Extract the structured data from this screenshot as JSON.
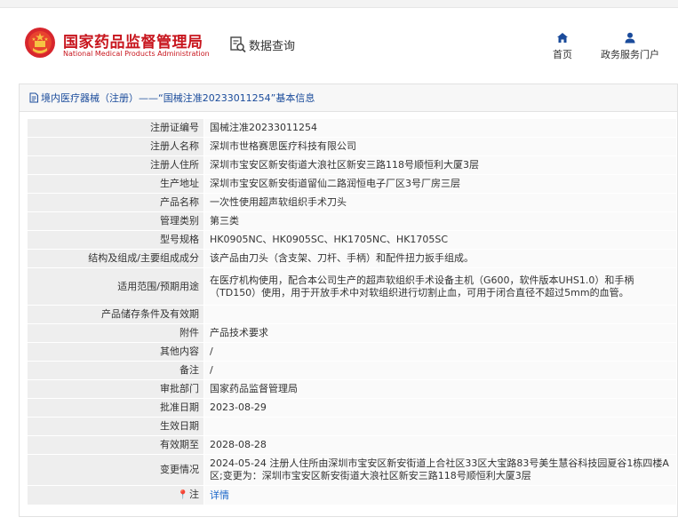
{
  "header": {
    "brand_cn": "国家药品监督管理局",
    "brand_en": "National Medical Products Administration",
    "query_label": "数据查询",
    "nav": [
      {
        "label": "首页",
        "icon": "home-icon"
      },
      {
        "label": "政务服务门户",
        "icon": "user-icon"
      }
    ]
  },
  "breadcrumb": "境内医疗器械（注册）——“国械注准20233011254”基本信息",
  "colors": {
    "brand_red": "#c8161e",
    "link_blue": "#1a66c9",
    "crumb_blue": "#1a4b9b"
  },
  "fields": [
    {
      "label": "注册证编号",
      "value": "国械注准20233011254"
    },
    {
      "label": "注册人名称",
      "value": "深圳市世格赛思医疗科技有限公司"
    },
    {
      "label": "注册人住所",
      "value": "深圳市宝安区新安街道大浪社区新安三路118号顺恒利大厦3层"
    },
    {
      "label": "生产地址",
      "value": "深圳市宝安区新安街道留仙二路润恒电子厂区3号厂房三层"
    },
    {
      "label": "产品名称",
      "value": "一次性使用超声软组织手术刀头"
    },
    {
      "label": "管理类别",
      "value": "第三类"
    },
    {
      "label": "型号规格",
      "value": "HK0905NC、HK0905SC、HK1705NC、HK1705SC"
    },
    {
      "label": "结构及组成/主要组成成分",
      "value": "该产品由刀头（含支架、刀杆、手柄）和配件扭力扳手组成。"
    },
    {
      "label": "适用范围/预期用途",
      "value": "在医疗机构使用，配合本公司生产的超声软组织手术设备主机（G600，软件版本UHS1.0）和手柄（TD150）使用，用于开放手术中对软组织进行切割止血，可用于闭合直径不超过5mm的血管。"
    },
    {
      "label": "产品储存条件及有效期",
      "value": ""
    },
    {
      "label": "附件",
      "value": "产品技术要求"
    },
    {
      "label": "其他内容",
      "value": "/"
    },
    {
      "label": "备注",
      "value": "/"
    },
    {
      "label": "审批部门",
      "value": "国家药品监督管理局"
    },
    {
      "label": "批准日期",
      "value": "2023-08-29"
    },
    {
      "label": "生效日期",
      "value": ""
    },
    {
      "label": "有效期至",
      "value": "2028-08-28"
    },
    {
      "label": "变更情况",
      "value": "2024-05-24 注册人住所由深圳市宝安区新安街道上合社区33区大宝路83号美生慧谷科技园夏谷1栋四楼A区;变更为：深圳市宝安区新安街道大浪社区新安三路118号顺恒利大厦3层"
    },
    {
      "label": "注",
      "value": "详情"
    }
  ]
}
